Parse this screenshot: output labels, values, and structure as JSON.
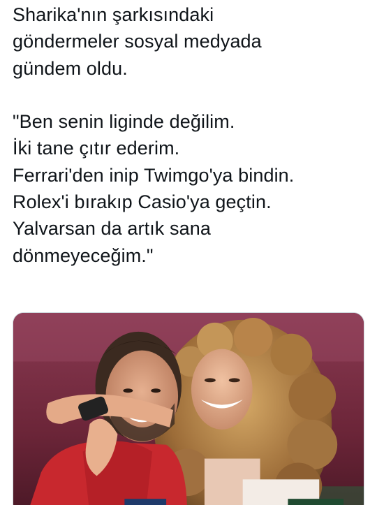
{
  "tweet": {
    "paragraph_1": [
      "Sharika'nın şarkısındaki",
      "göndermeler sosyal medyada",
      "gündem oldu."
    ],
    "paragraph_2": [
      "\"Ben senin liginde değilim.",
      "İki tane çıtır ederim.",
      "Ferrari'den inip Twimgo'ya bindin.",
      "Rolex'i bırakıp Casio'ya geçtin.",
      "Yalvarsan da artık sana",
      "dönmeyeceğim.\""
    ]
  },
  "media": {
    "type": "photo",
    "colors": {
      "background": "#7a3045",
      "shirt_red": "#c8282e",
      "hair_curly": "#b98a4e",
      "skin": "#e0a98a"
    }
  }
}
